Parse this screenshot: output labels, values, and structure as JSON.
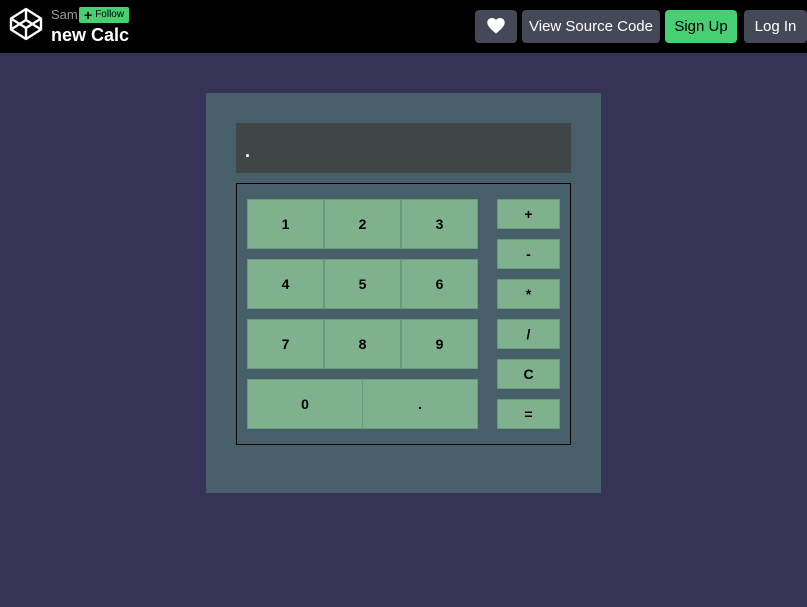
{
  "header": {
    "author": "Sam",
    "follow_label": "Follow",
    "title": "new Calc",
    "buttons": {
      "like_icon": "heart-icon",
      "view_source": "View Source Code",
      "signup": "Sign Up",
      "login": "Log In"
    }
  },
  "calculator": {
    "display": ".",
    "rows": [
      [
        "1",
        "2",
        "3"
      ],
      [
        "4",
        "5",
        "6"
      ],
      [
        "7",
        "8",
        "9"
      ],
      [
        "0",
        "."
      ]
    ],
    "operators": [
      "+",
      "-",
      "*",
      "/",
      "C",
      "="
    ]
  },
  "colors": {
    "background": "#353457",
    "topbar": "#000000",
    "accent_green": "#47cf73",
    "calc_body": "#475f69",
    "display_bg": "#404548",
    "key": "#80b18f"
  }
}
